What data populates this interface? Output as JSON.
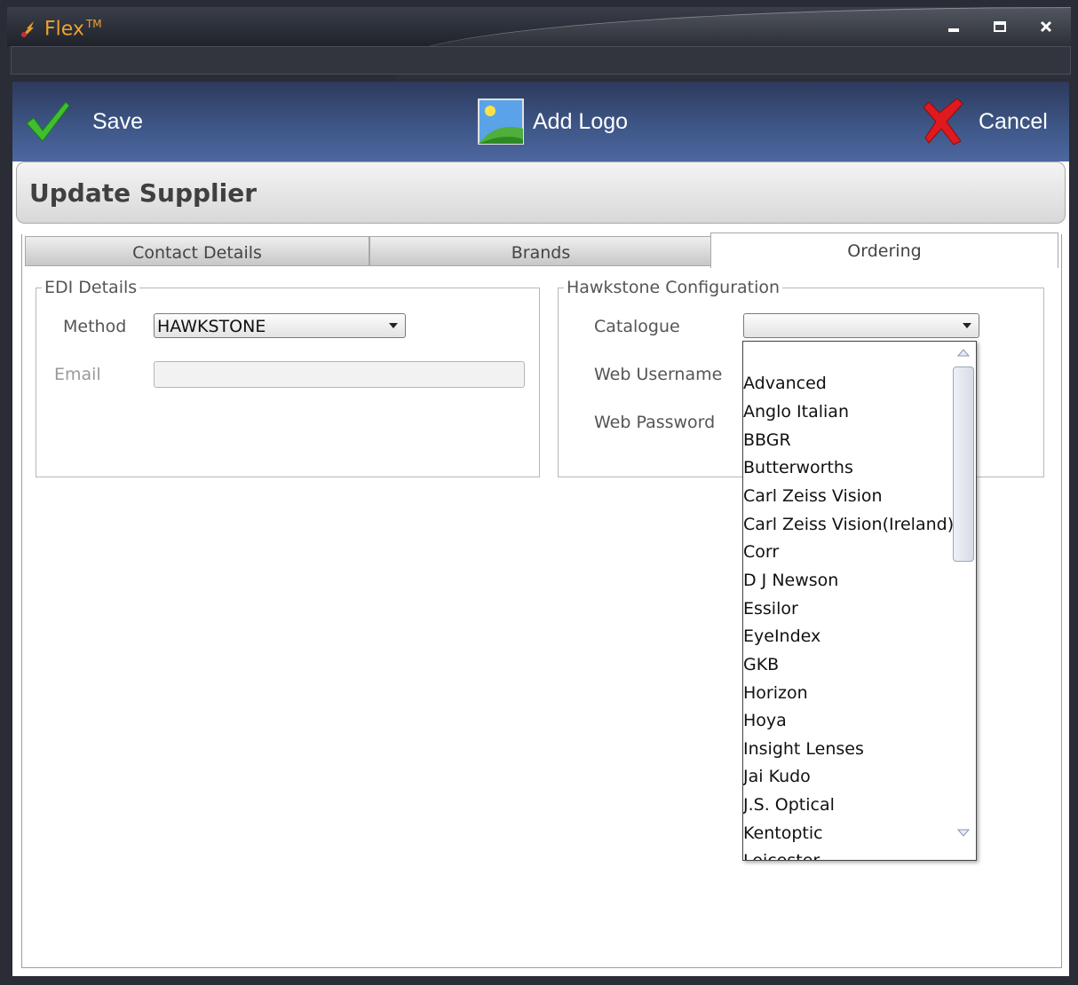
{
  "window": {
    "app_name": "Flex",
    "trademark": "TM",
    "minimize": "–",
    "maximize": "□",
    "close": "×"
  },
  "toolbar": {
    "save_label": "Save",
    "add_logo_label": "Add Logo",
    "cancel_label": "Cancel"
  },
  "header": {
    "title": "Update Supplier"
  },
  "tabs": [
    {
      "label": "Contact Details",
      "active": false
    },
    {
      "label": "Brands",
      "active": false
    },
    {
      "label": "Ordering",
      "active": true
    }
  ],
  "edi": {
    "legend": "EDI Details",
    "method_label": "Method",
    "method_value": "HAWKSTONE",
    "email_label": "Email",
    "email_value": ""
  },
  "hawkstone": {
    "legend": "Hawkstone Configuration",
    "catalogue_label": "Catalogue",
    "catalogue_value": "",
    "web_username_label": "Web Username",
    "web_password_label": "Web Password"
  },
  "catalogue_options": [
    "",
    "Advanced",
    "Anglo Italian",
    "BBGR",
    "Butterworths",
    "Carl Zeiss Vision",
    "Carl Zeiss Vision(Ireland)",
    "Corr",
    "D J Newson",
    "Essilor",
    "EyeIndex",
    "GKB",
    "Horizon",
    "Hoya",
    "Insight Lenses",
    "Jai Kudo",
    "J.S. Optical",
    "Kentoptic",
    "Leicester"
  ]
}
